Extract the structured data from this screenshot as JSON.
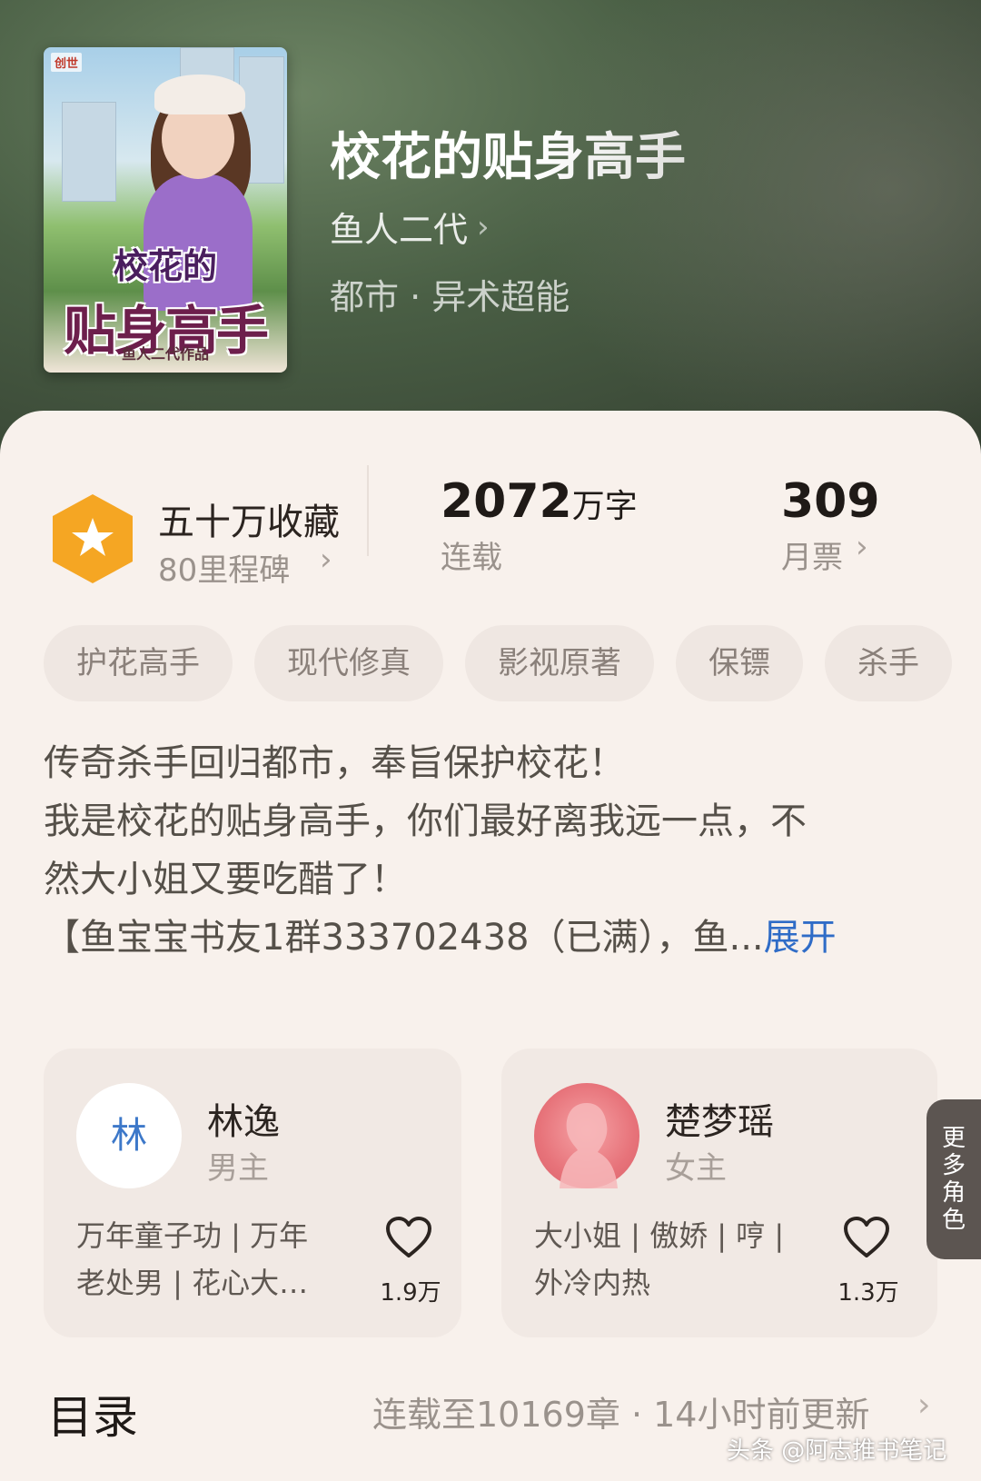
{
  "book": {
    "title": "校花的贴身高手",
    "author": "鱼人二代",
    "genre": "都市 · 异术超能",
    "cover": {
      "title_line1": "校花的",
      "title_line2": "贴身高手",
      "author_credit": "鱼人二代作品",
      "publisher": "创世"
    }
  },
  "stats": {
    "collection_title": "五十万收藏",
    "milestones": "80里程碑",
    "word_count": "2072",
    "word_unit": "万字",
    "status": "连载",
    "monthly_votes": "309",
    "monthly_votes_label": "月票"
  },
  "tags": [
    "护花高手",
    "现代修真",
    "影视原著",
    "保镖",
    "杀手"
  ],
  "description": {
    "line1": "传奇杀手回归都市，奉旨保护校花！",
    "line2": "我是校花的贴身高手，你们最好离我远一点，不",
    "line3": "然大小姐又要吃醋了！",
    "line4": "【鱼宝宝书友1群333702438（已满），鱼...",
    "expand": "展开"
  },
  "characters": [
    {
      "avatar_text": "林",
      "name": "林逸",
      "role": "男主",
      "desc_line1": "万年童子功 | 万年",
      "desc_line2": "老处男 | 花心大…",
      "likes": "1.9万"
    },
    {
      "avatar_text": "",
      "name": "楚梦瑶",
      "role": "女主",
      "desc_line1": "大小姐 | 傲娇 | 哼 |",
      "desc_line2": "外冷内热",
      "likes": "1.3万"
    }
  ],
  "more_roles": [
    "更",
    "多",
    "角",
    "色"
  ],
  "toc": {
    "title": "目录",
    "info": "连载至10169章 · 14小时前更新"
  },
  "watermark": "头条 @阿志推书笔记",
  "colors": {
    "expand_link": "#2f6cc7",
    "badge": "#f5a623",
    "female_avatar": "#e7737a"
  }
}
